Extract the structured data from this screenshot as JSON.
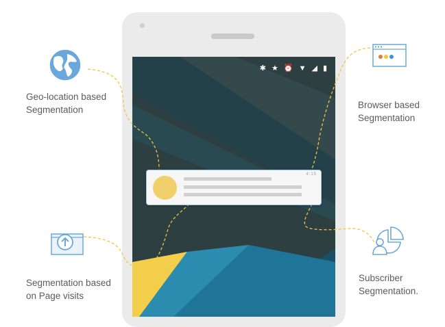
{
  "segments": {
    "geo": {
      "line1": "Geo-location based",
      "line2": "Segmentation",
      "icon": "globe-icon"
    },
    "browser": {
      "line1": "Browser based",
      "line2": "Segmentation",
      "icon": "browser-window-icon"
    },
    "page": {
      "line1": "Segmentation based",
      "line2": "on Page visits",
      "icon": "page-visit-icon"
    },
    "subscriber": {
      "line1": "Subscriber",
      "line2": "Segmentation.",
      "icon": "subscriber-icon"
    }
  },
  "phone": {
    "status_icons": [
      "bluetooth-icon",
      "star-icon",
      "alarm-icon",
      "wifi-icon",
      "signal-icon",
      "battery-icon"
    ],
    "notification": {
      "time": "4:15"
    }
  },
  "colors": {
    "connector": "#f2c53d",
    "icon_blue": "#5ea2d6",
    "screen_dark": "#2c3e40",
    "screen_teal": "#1f7597",
    "screen_yellow": "#f3ce4a"
  }
}
